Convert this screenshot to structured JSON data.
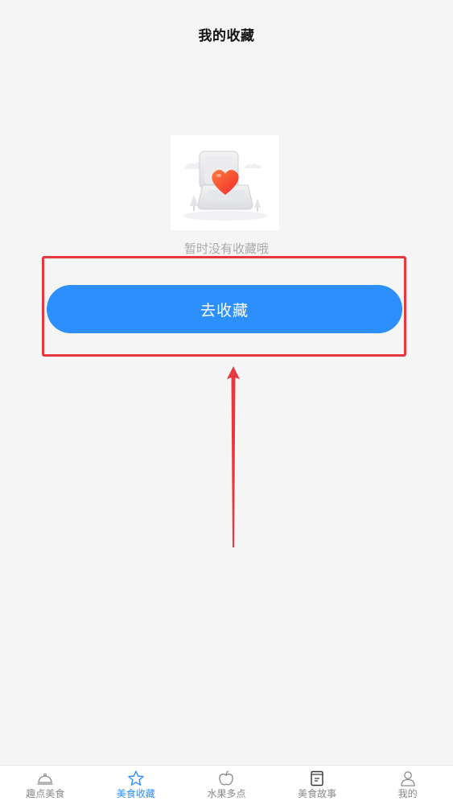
{
  "header": {
    "title": "我的收藏"
  },
  "empty_state": {
    "illustration": "heart-box-illustration",
    "message": "暂时没有收藏哦",
    "button_label": "去收藏"
  },
  "annotation": {
    "color": "#e8373d"
  },
  "theme": {
    "accent": "#2d8ffb",
    "background": "#f5f5f5"
  },
  "tabbar": {
    "active_index": 1,
    "items": [
      {
        "label": "趣点美食",
        "icon": "cloche-icon"
      },
      {
        "label": "美食收藏",
        "icon": "star-icon"
      },
      {
        "label": "水果多点",
        "icon": "apple-icon"
      },
      {
        "label": "美食故事",
        "icon": "book-icon"
      },
      {
        "label": "我的",
        "icon": "person-icon"
      }
    ]
  }
}
